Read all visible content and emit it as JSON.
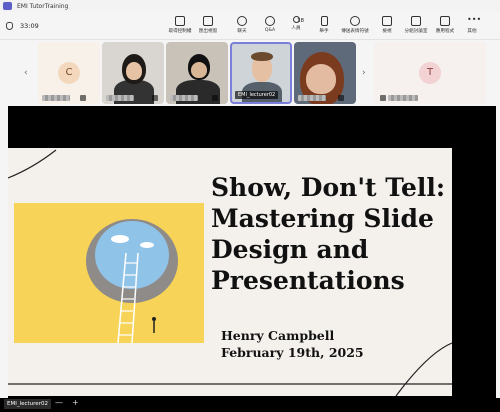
{
  "window": {
    "title": "EMI TutorTraining"
  },
  "toolbar": {
    "timer": "33:09",
    "buttons": [
      {
        "id": "take-control",
        "label": "取得控制權",
        "icon": "take-control-icon"
      },
      {
        "id": "stop-present",
        "label": "匯出視窗",
        "icon": "share-window-icon"
      },
      {
        "id": "chat",
        "label": "聊天",
        "icon": "chat-icon"
      },
      {
        "id": "qa",
        "label": "Q&A",
        "icon": "qa-icon"
      },
      {
        "id": "people",
        "label": "人員",
        "icon": "people-icon",
        "count": "18"
      },
      {
        "id": "raise",
        "label": "舉手",
        "icon": "raise-hand-icon"
      },
      {
        "id": "react",
        "label": "傳送表情符號",
        "icon": "emoji-icon"
      },
      {
        "id": "view",
        "label": "檢視",
        "icon": "view-icon"
      },
      {
        "id": "rooms",
        "label": "分組討論室",
        "icon": "breakout-rooms-icon"
      },
      {
        "id": "apps",
        "label": "應用程式",
        "icon": "apps-icon"
      },
      {
        "id": "more",
        "label": "其他",
        "icon": "more-icon"
      }
    ]
  },
  "participants": {
    "left_initial": "C",
    "right_initial": "T",
    "presenter_name": "EMI_lecturer02"
  },
  "slide": {
    "title_lines": [
      "Show, Don't Tell:",
      "Mastering Slide",
      "Design and",
      "Presentations"
    ],
    "author": "Henry Campbell",
    "date": "February 19th, 2025"
  },
  "bottom": {
    "speaker": "EMI_lecturer02",
    "zoom_out": "—",
    "zoom_in": "+"
  },
  "colors": {
    "accent": "#5b5fc7",
    "slide_bg": "#f4f1ec",
    "illustration_bg": "#f7d457",
    "sky": "#8fc3e8"
  }
}
